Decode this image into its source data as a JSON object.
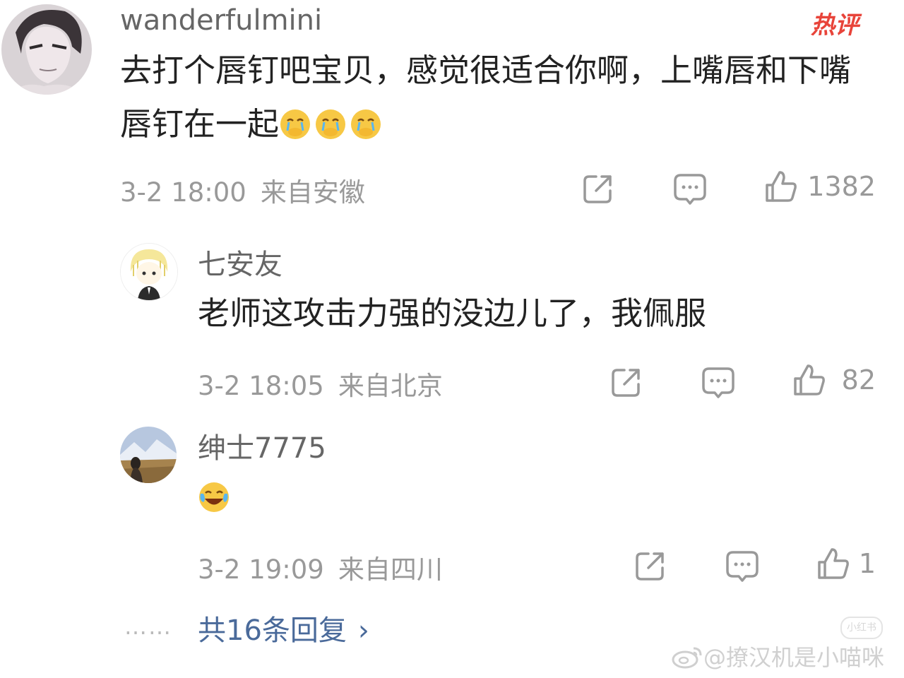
{
  "hot_badge": "热评",
  "comments": [
    {
      "username": "wanderfulmini",
      "content": "去打个唇钉吧宝贝，感觉很适合你啊，上嘴唇和下嘴唇钉在一起",
      "emoji": [
        "cry-cover-mouth-emoji",
        "cry-cover-mouth-emoji",
        "cry-cover-mouth-emoji"
      ],
      "time": "3-2 18:00",
      "location": "来自安徽",
      "likes": "1382"
    },
    {
      "username": "七安友",
      "content": "老师这攻击力强的没边儿了，我佩服",
      "time": "3-2 18:05",
      "location": "来自北京",
      "likes": "82"
    },
    {
      "username": "绅士7775",
      "content": "",
      "emoji": [
        "laugh-cry-emoji"
      ],
      "time": "3-2 19:09",
      "location": "来自四川",
      "likes": "1"
    }
  ],
  "more": {
    "dots": "……",
    "label": "共16条回复",
    "chevron": "›"
  },
  "watermark": "@撩汉机是小喵咪",
  "small_badge": "小红书",
  "icons": [
    "share-icon",
    "comment-icon",
    "like-icon",
    "chevron-right-icon",
    "weibo-icon"
  ],
  "colors": {
    "link": "#4a6a9a",
    "hot": "#e8443a",
    "meta": "#999999"
  }
}
